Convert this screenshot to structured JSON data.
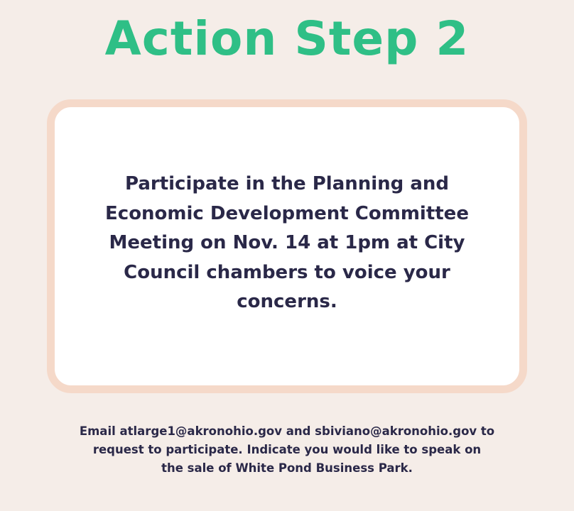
{
  "title": "Action Step 2",
  "card": {
    "line1": "Participate in the Planning and",
    "line2": "Economic Development Committee",
    "line3": "Meeting on Nov. 14 at 1pm at City",
    "line4": "Council chambers to voice your",
    "line5": "concerns."
  },
  "footer": {
    "line1": "Email atlarge1@akronohio.gov and sbiviano@akronohio.gov to",
    "line2": "request to participate. Indicate you would like to speak on",
    "line3": "the sale of White Pond Business Park."
  },
  "colors": {
    "background": "#f5ede8",
    "title": "#2fbf86",
    "card_border": "#f5d9c9",
    "text": "#2a2848"
  }
}
